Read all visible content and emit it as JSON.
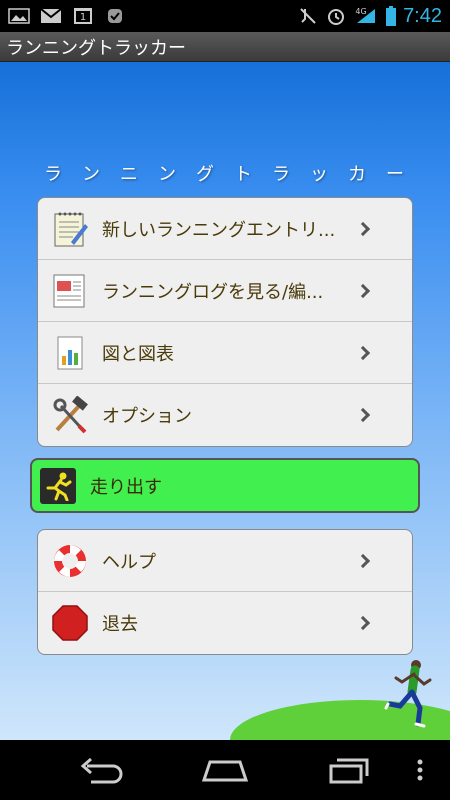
{
  "status_bar": {
    "time": "7:42",
    "network_type": "4G",
    "notification_count": "1",
    "icons": [
      "image-icon",
      "gmail-icon",
      "calendar-icon",
      "app-icon",
      "muted-icon",
      "alarm-icon",
      "signal-icon",
      "battery-icon"
    ]
  },
  "app": {
    "title": "ランニングトラッカー",
    "banner": "ランニングトラッカー"
  },
  "menu_group_1": [
    {
      "label": "新しいランニングエントリ...",
      "icon": "notepad-icon"
    },
    {
      "label": "ランニングログを見る/編...",
      "icon": "log-icon"
    },
    {
      "label": "図と図表",
      "icon": "chart-icon"
    },
    {
      "label": "オプション",
      "icon": "tools-icon"
    }
  ],
  "run_button": {
    "label": "走り出す",
    "icon": "runner-icon",
    "color": "#41ef4e"
  },
  "menu_group_2": [
    {
      "label": "ヘルプ",
      "icon": "lifebuoy-icon"
    },
    {
      "label": "退去",
      "icon": "stop-icon"
    }
  ],
  "nav": {
    "icons": [
      "back-icon",
      "home-icon",
      "recents-icon",
      "menu-icon"
    ]
  },
  "colors": {
    "accent_blue": "#33b5e5",
    "sky_top": "#1670d8",
    "label_text": "#4a3a08"
  }
}
